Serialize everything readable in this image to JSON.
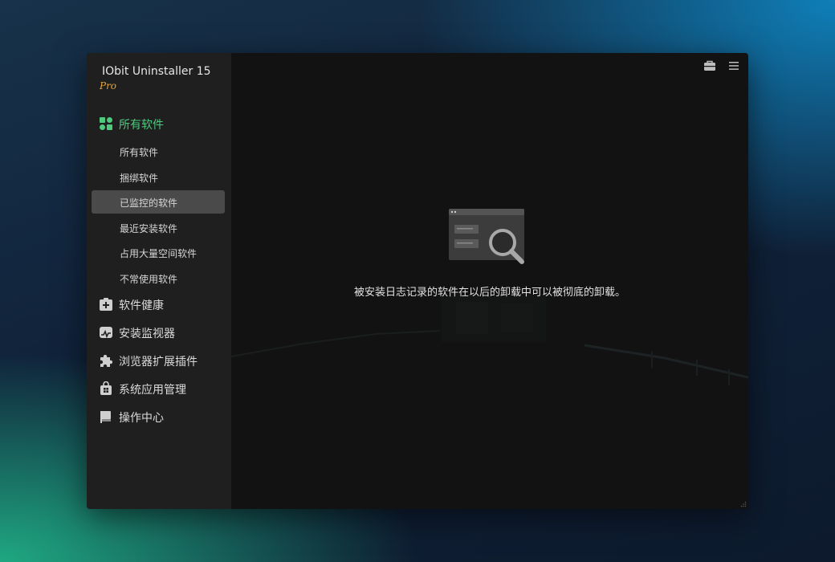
{
  "app": {
    "title": "IObit Uninstaller 15",
    "edition": "Pro"
  },
  "sidebar": {
    "sections": [
      {
        "label": "所有软件",
        "icon": "grid-apps-icon",
        "active": true
      },
      {
        "label": "软件健康",
        "icon": "health-kit-icon",
        "active": false
      },
      {
        "label": "安装监视器",
        "icon": "monitor-gauge-icon",
        "active": false
      },
      {
        "label": "浏览器扩展插件",
        "icon": "puzzle-icon",
        "active": false
      },
      {
        "label": "系统应用管理",
        "icon": "windows-bag-icon",
        "active": false
      },
      {
        "label": "操作中心",
        "icon": "flag-icon",
        "active": false
      }
    ],
    "sub_items": [
      {
        "label": "所有软件",
        "selected": false
      },
      {
        "label": "捆绑软件",
        "selected": false
      },
      {
        "label": "已监控的软件",
        "selected": true
      },
      {
        "label": "最近安装软件",
        "selected": false
      },
      {
        "label": "占用大量空间软件",
        "selected": false
      },
      {
        "label": "不常使用软件",
        "selected": false
      }
    ]
  },
  "titlebar": {
    "buttons": [
      "toolbox-icon",
      "menu-icon",
      "minimize-icon",
      "maximize-icon",
      "close-icon"
    ]
  },
  "main": {
    "empty_message": "被安装日志记录的软件在以后的卸载中可以被彻底的卸载。",
    "illustration": "window-search-icon"
  },
  "colors": {
    "accent": "#4ec97e",
    "edition": "#e7a33a",
    "sidebar_bg": "#1f1f1f",
    "main_bg": "#121212",
    "selected_bg": "#4a4a4a"
  }
}
